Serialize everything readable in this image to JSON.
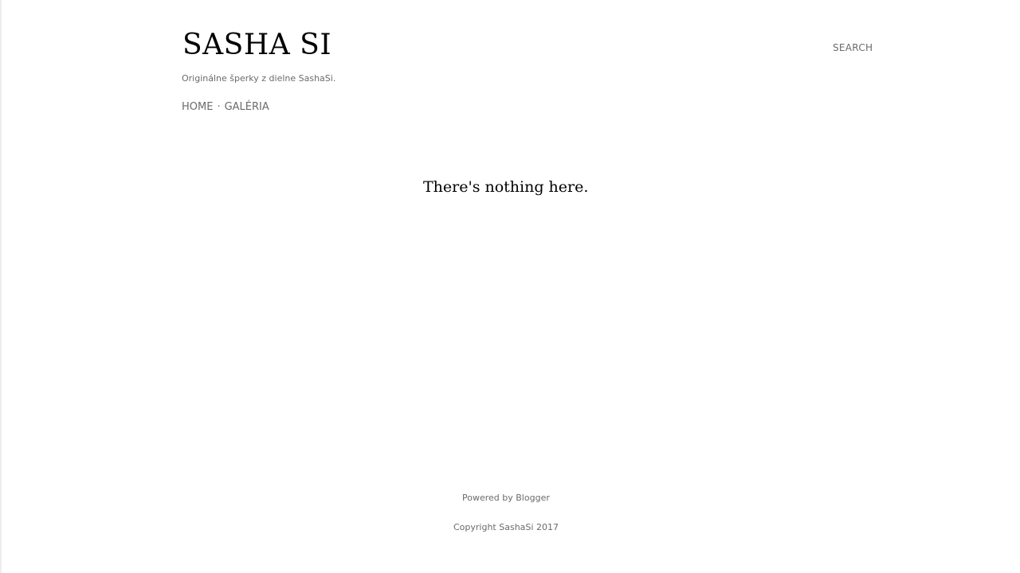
{
  "header": {
    "title": "SASHA SI",
    "tagline": "Originálne šperky z dielne SashaSi.",
    "search_label": "SEARCH"
  },
  "nav": {
    "items": [
      {
        "label": "HOME"
      },
      {
        "label": "GALÉRIA"
      }
    ],
    "separator": "·"
  },
  "main": {
    "empty_message": "There's nothing here."
  },
  "footer": {
    "powered_prefix": "Powered by ",
    "powered_link": "Blogger",
    "copyright": "Copyright SashaSi 2017"
  }
}
